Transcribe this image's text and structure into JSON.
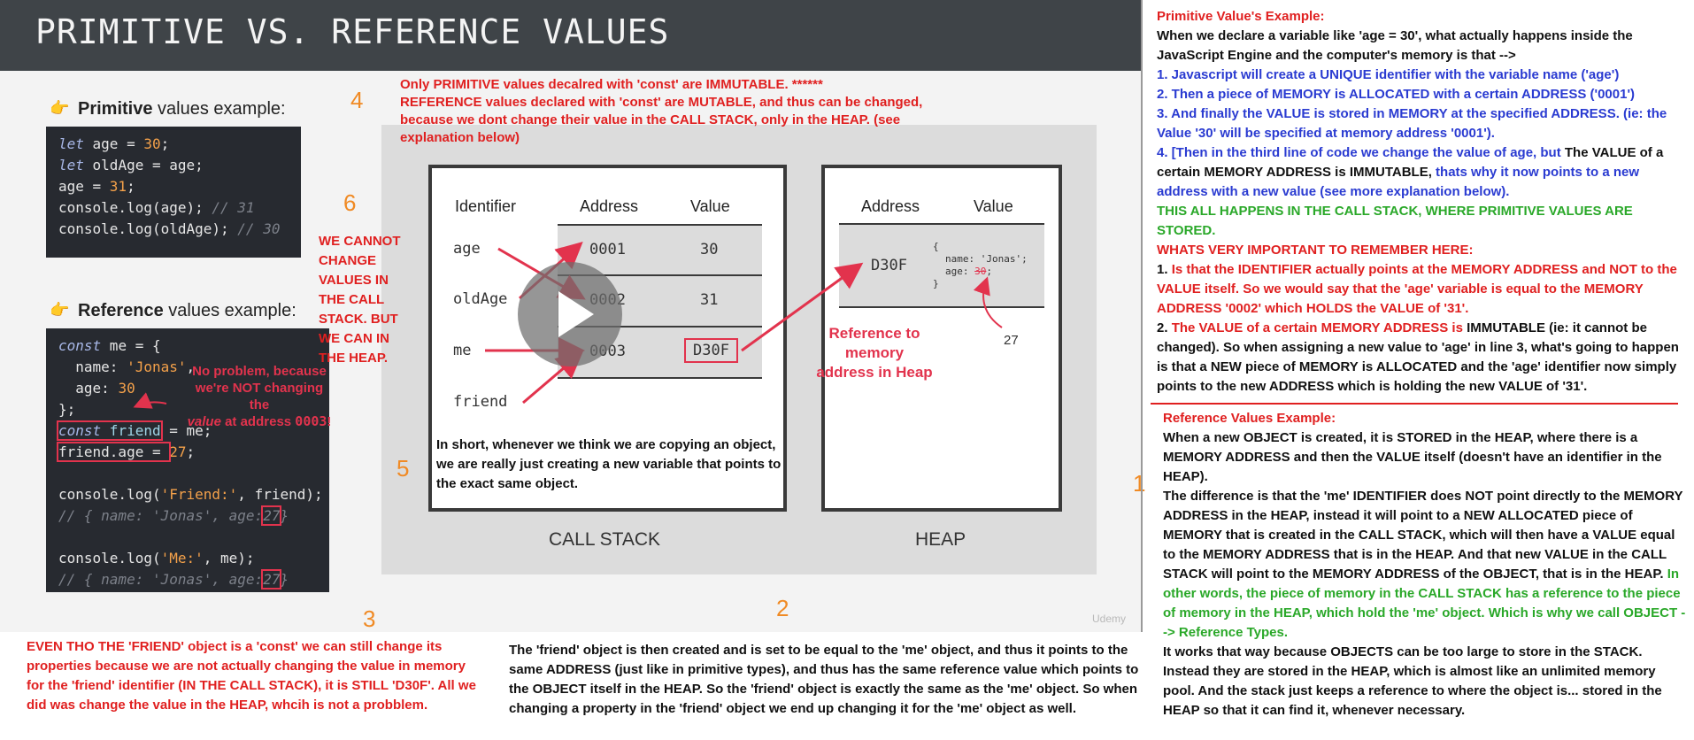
{
  "slide": {
    "title": "PRIMITIVE VS. REFERENCE VALUES",
    "primitive_label_bold": "Primitive",
    "primitive_label_rest": " values example:",
    "reference_label_bold": "Reference",
    "reference_label_rest": " values example:",
    "primitive_code": {
      "l1_kw": "let",
      "l1_rest": " age = ",
      "l1_num": "30",
      "l1_end": ";",
      "l2_kw": "let",
      "l2_rest": " oldAge = age;",
      "l3_rest": "age = ",
      "l3_num": "31",
      "l3_end": ";",
      "l4_rest": "console.log(age); ",
      "l4_cm": "// 31",
      "l5_rest": "console.log(oldAge); ",
      "l5_cm": "// 30"
    },
    "reference_code": {
      "l1_kw": "const",
      "l1_rest": " me = {",
      "l2_rest": "  name: ",
      "l2_str": "'Jonas'",
      "l2_end": ",",
      "l3_rest": "  age: ",
      "l3_num": "30",
      "l4_rest": "};",
      "l5_kw": "const",
      "l5_mid": " friend",
      "l5_rest": " = me;",
      "l6_rest": "friend.age",
      "l6_mid": " = ",
      "l6_num": "27",
      "l6_end": ";",
      "l7_rest": "console.log(",
      "l7_str": "'Friend:'",
      "l7_end": ", friend);",
      "l8_cm": "// { name: 'Jonas', age:",
      "l8_box": "27",
      "l8_end": "}",
      "l9_rest": "console.log(",
      "l9_str": "'Me:'",
      "l9_end": ", me);",
      "l10_cm": "// { name: 'Jonas', age:",
      "l10_box": "27",
      "l10_end": "}"
    },
    "no_problem_note": [
      "No problem, because",
      "we're NOT changing the",
      "value",
      " at address ",
      "0003",
      "!"
    ],
    "call_stack": {
      "headers": [
        "Identifier",
        "Address",
        "Value"
      ],
      "rows": [
        {
          "id": "age",
          "addr": "0001",
          "val": "30"
        },
        {
          "id": "oldAge",
          "addr": "0002",
          "val": "31"
        },
        {
          "id": "me",
          "addr": "0003",
          "val": "D30F"
        },
        {
          "id": "friend",
          "addr": "",
          "val": ""
        }
      ],
      "caption": "CALL STACK"
    },
    "heap": {
      "headers": [
        "Address",
        "Value"
      ],
      "addr": "D30F",
      "obj_l1": "{",
      "obj_l2": "name: 'Jonas';",
      "obj_l3": "age: ",
      "obj_l3_old": "30",
      "obj_l3_end": ";",
      "obj_l4": "}",
      "new_age": "27",
      "caption": "HEAP"
    },
    "reference_to_heap": [
      "Reference to memory",
      "address in Heap"
    ],
    "in_short": "In short, whenever we think we are copying an object, we are really just creating a new variable that points to the exact same object.",
    "watermark": "Udemy"
  },
  "annotations": {
    "n4": "4",
    "n6": "6",
    "n5": "5",
    "n3": "3",
    "n2": "2",
    "n1": "1",
    "immutable_note_1": "Only PRIMITIVE values decalred with 'const' are IMMUTABLE. ******",
    "immutable_note_2": "REFERENCE values declared with 'const' are MUTABLE, and thus can be changed, because we dont change their value in the CALL STACK, only in the HEAP. (see explanation below)",
    "cannot_change": [
      "WE CANNOT",
      "CHANGE",
      "VALUES IN",
      "THE CALL",
      "STACK. BUT",
      "WE CAN IN",
      "THE HEAP."
    ],
    "friend_const_note": "EVEN THO THE 'FRIEND' object is a 'const' we can still change its properties because we are not actually changing the value in memory for the 'friend' identifier (IN THE CALL STACK), it is STILL 'D30F'. All we did was change the value in the HEAP, whcih is not a probblem.",
    "friend_obj_note": "The 'friend' object is then created and is set to be equal to the 'me' object, and thus it points to the same ADDRESS (just like in primitive types), and thus has the same reference value which points to the OBJECT itself in the HEAP. So the 'friend' object is exactly the same as the 'me' object. So when changing a property in the 'friend' object we end up changing it for the 'me' object as well."
  },
  "right_panel": {
    "prim_title": "Primitive Value's Example:",
    "prim_intro": "When we declare a variable like 'age = 30', what actually happens inside the JavaScript Engine and the computer's memory is that -->",
    "prim_s1": "1. Javascript will create a UNIQUE identifier with the variable name ('age')",
    "prim_s2": "2. Then a piece of MEMORY is ALLOCATED with a certain ADDRESS ('0001')",
    "prim_s3": "3. And finally the VALUE is stored in MEMORY at the specified ADDRESS. (ie: the Value '30' will be specified at memory address '0001').",
    "prim_s4a": "4. [Then in the third line of code we change the value of age, but ",
    "prim_s4b": " The VALUE of a certain MEMORY ADDRESS is IMMUTABLE,",
    "prim_s4c": " thats why it now points to a new address with a new value (see more explanation below).",
    "prim_green": "THIS ALL HAPPENS IN THE CALL STACK, WHERE PRIMITIVE VALUES ARE STORED.",
    "prim_important": "WHATS VERY IMPORTANT TO REMEMBER HERE:",
    "prim_i1a": "1. ",
    "prim_i1b": "Is that the IDENTIFIER actually points at the MEMORY ADDRESS and NOT to the VALUE itself. So we would say that the 'age' variable is equal to the MEMORY ADDRESS '0002' which HOLDS the VALUE of '31'.",
    "prim_i2a": "2. ",
    "prim_i2b": "The VALUE of a certain MEMORY ADDRESS is",
    "prim_i2c": " IMMUTABLE (ie: it cannot be changed). So when assigning a new value to 'age' in line 3, what's going to happen is that a NEW piece of MEMORY is ALLOCATED and the 'age' identifier now simply points to the new ADDRESS which is holding the new VALUE of '31'.",
    "ref_title": "Reference Values Example:",
    "ref_p1": "When a new OBJECT is created, it is STORED in the HEAP, where there is a MEMORY ADDRESS and then the VALUE itself (doesn't have an identifier in the HEAP).",
    "ref_p2a": "The difference is that the 'me' IDENTIFIER does NOT point directly to the MEMORY ADDRESS in the HEAP, instead it will point to a NEW ALLOCATED piece of MEMORY that is created in the CALL STACK, which will then have a VALUE equal to the MEMORY ADDRESS that is in the HEAP. And that new VALUE in the CALL STACK will point to the MEMORY ADDRESS of the OBJECT, that is in the HEAP.",
    "ref_p2b": " In other words, the piece of memory in the CALL STACK has a reference to the piece of memory in the HEAP, which hold the 'me' object. Which is why we call OBJECT --> Reference Types.",
    "ref_p3": "It works that way because OBJECTS can be too large to store in the STACK. Instead they are stored in the HEAP, which is almost like an unlimited memory pool. And the stack just keeps a reference to where the object is... stored in the HEAP so that it can find it, whenever necessary."
  },
  "colors": {
    "accent_red": "#e02020",
    "blue": "#2a3bd1",
    "green": "#2aa829",
    "orange": "#f08a24",
    "header": "#3f4448"
  }
}
